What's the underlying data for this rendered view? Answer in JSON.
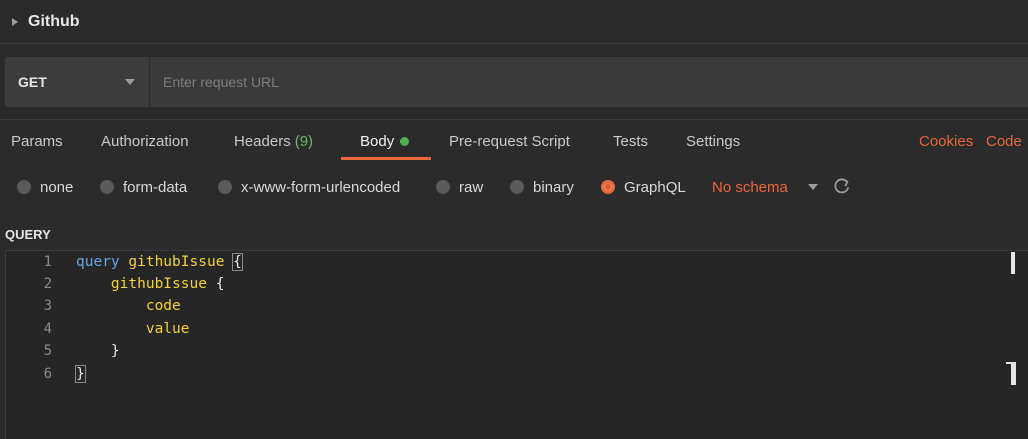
{
  "collection": {
    "title": "Github"
  },
  "request": {
    "method": "GET",
    "url_placeholder": "Enter request URL",
    "url_value": ""
  },
  "tabs": [
    {
      "label": "Params"
    },
    {
      "label": "Authorization"
    },
    {
      "label": "Headers",
      "count": "(9)"
    },
    {
      "label": "Body",
      "active": true
    },
    {
      "label": "Pre-request Script"
    },
    {
      "label": "Tests"
    },
    {
      "label": "Settings"
    }
  ],
  "links": {
    "cookies": "Cookies",
    "code": "Code"
  },
  "body_types": [
    {
      "label": "none"
    },
    {
      "label": "form-data"
    },
    {
      "label": "x-www-form-urlencoded"
    },
    {
      "label": "raw"
    },
    {
      "label": "binary"
    },
    {
      "label": "GraphQL",
      "selected": true
    }
  ],
  "schema": {
    "label": "No schema"
  },
  "query": {
    "section_label": "QUERY",
    "line_numbers": [
      "1",
      "2",
      "3",
      "4",
      "5",
      "6"
    ],
    "keyword": "query",
    "operation_name": "githubIssue",
    "field": "githubIssue",
    "subfields": [
      "code",
      "value"
    ],
    "open_brace": "{",
    "close_brace": "}"
  },
  "colors": {
    "accent": "#e8673d",
    "keyword": "#6aa6e0",
    "identifier": "#f3d23b",
    "count": "#6bb86b",
    "dot": "#4caf50"
  },
  "icons": [
    "caret-right-icon",
    "chevron-down-icon",
    "refresh-icon",
    "status-dot-icon"
  ]
}
